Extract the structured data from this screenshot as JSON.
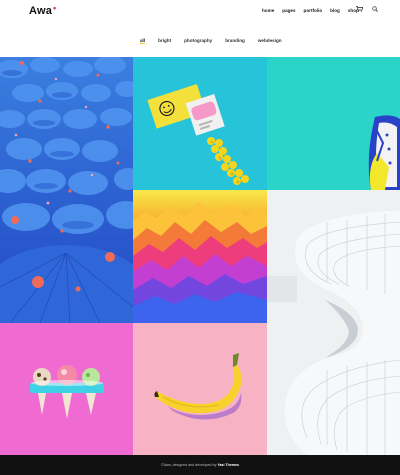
{
  "brand": {
    "name": "Awa",
    "dot": "•"
  },
  "nav": {
    "items": [
      "home",
      "pages",
      "portfolio",
      "blog",
      "shop"
    ],
    "cart_icon": "cart-icon",
    "search_icon": "search-icon"
  },
  "filters": {
    "items": [
      "all",
      "bright",
      "photography",
      "branding",
      "webdesign"
    ],
    "active": "all"
  },
  "portfolio": {
    "tiles": [
      {
        "name": "blue-umbrellas",
        "accent": "#2c5fd0"
      },
      {
        "name": "smiley-card",
        "accent": "#27c3d8"
      },
      {
        "name": "sneaker",
        "accent": "#2bd4c9"
      },
      {
        "name": "gradient-mountains",
        "accent": "#ef3f7e"
      },
      {
        "name": "white-architecture",
        "accent": "#e9ecef"
      },
      {
        "name": "ice-cream-cones",
        "accent": "#f06bd1"
      },
      {
        "name": "banana",
        "accent": "#f7b3c4"
      }
    ]
  },
  "footer": {
    "prefix": "©Awa, designed and developed by",
    "author": "Yazi Themes"
  }
}
